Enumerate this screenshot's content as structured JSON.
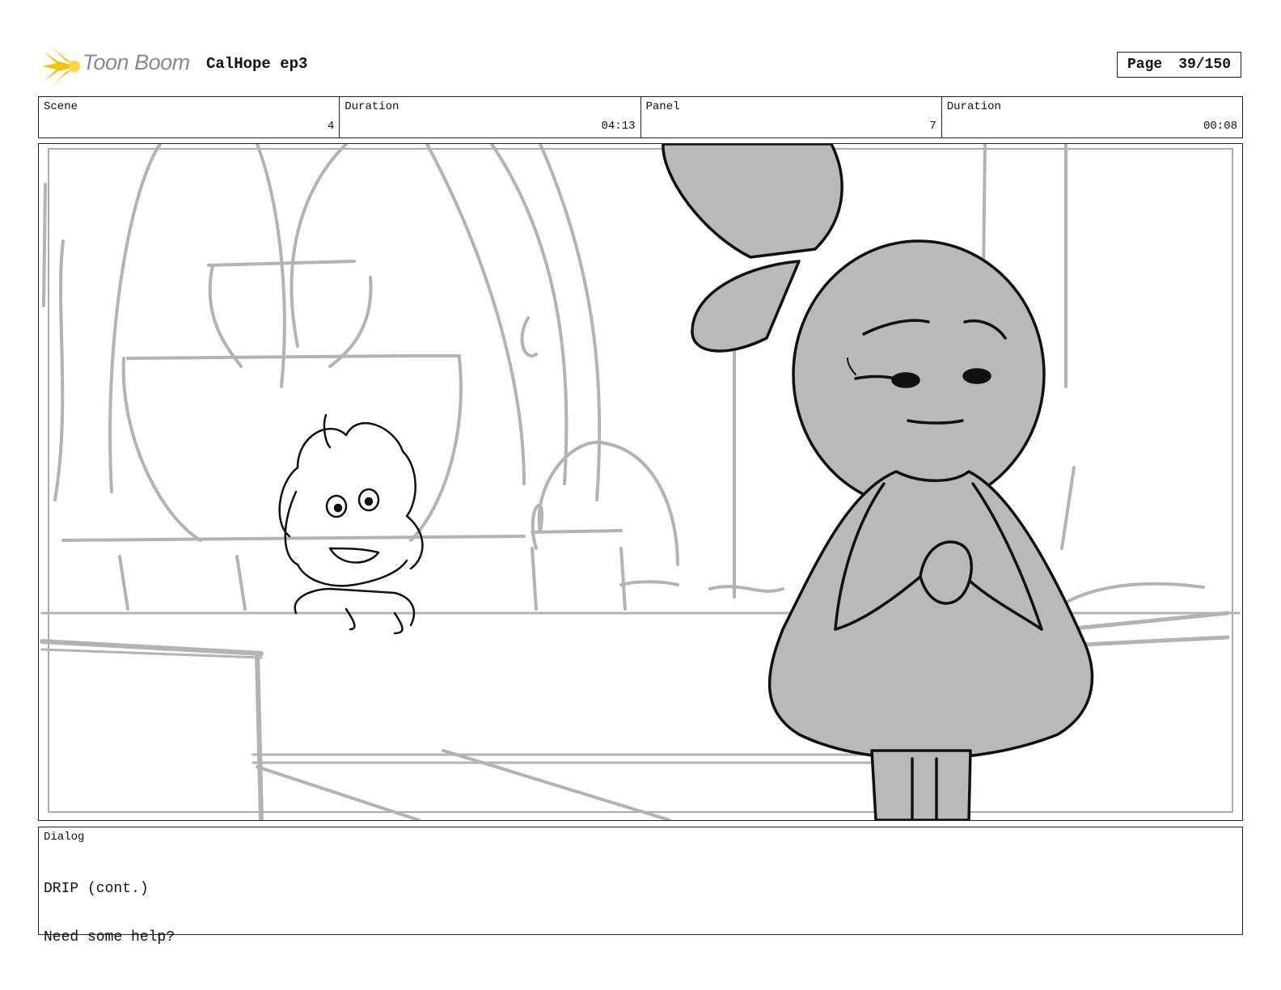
{
  "header": {
    "logo_text": "Toon Boom",
    "project_title": "CalHope ep3",
    "page_label": "Page",
    "page_value": "39/150"
  },
  "info": [
    {
      "label": "Scene",
      "value": "4"
    },
    {
      "label": "Duration",
      "value": "04:13"
    },
    {
      "label": "Panel",
      "value": "7"
    },
    {
      "label": "Duration",
      "value": "00:08"
    }
  ],
  "dialog": {
    "label": "Dialog",
    "lines": [
      "DRIP (cont.)",
      "Need some help?"
    ]
  },
  "colors": {
    "logo_yellow": "#f5c400",
    "sketch_gray": "#b3b3b3",
    "character_fill": "#b9b9b9",
    "ink": "#111111"
  }
}
